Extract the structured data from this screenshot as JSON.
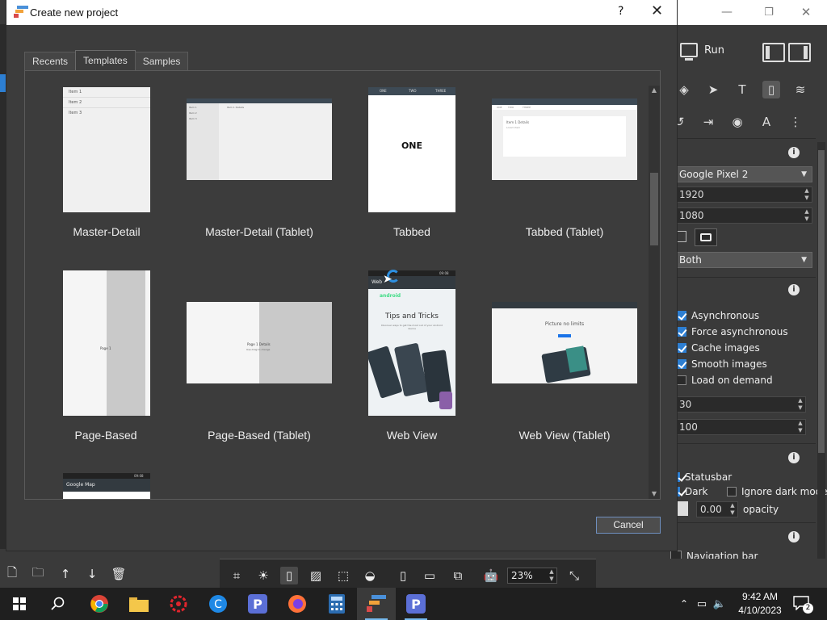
{
  "dialog": {
    "title": "Create new project",
    "help_label": "?",
    "close_label": "✕",
    "cancel_label": "Cancel",
    "tabs": [
      {
        "label": "Recents",
        "active": false
      },
      {
        "label": "Templates",
        "active": true
      },
      {
        "label": "Samples",
        "active": false
      }
    ],
    "templates": [
      {
        "label": "Master-Detail",
        "preview_items": [
          "Item 1",
          "Item 2",
          "Item 3"
        ]
      },
      {
        "label": "Master-Detail (Tablet)",
        "preview_items": [
          "Item 1",
          "Item 2",
          "Item 3"
        ],
        "preview_detail": "Item 1 Details"
      },
      {
        "label": "Tabbed",
        "preview_tabs": [
          "ONE",
          "TWO",
          "THREE"
        ],
        "preview_text": "ONE"
      },
      {
        "label": "Tabbed (Tablet)",
        "preview_tabs": [
          "ONE",
          "TWO",
          "THREE"
        ],
        "preview_text": "Item 1 Details",
        "preview_sub": "Lorem Item"
      },
      {
        "label": "Page-Based",
        "preview_text": "Page 1"
      },
      {
        "label": "Page-Based (Tablet)",
        "preview_text": "Page 1 Details",
        "preview_sub": "Use drag to change"
      },
      {
        "label": "Web View",
        "preview_time": "09:08",
        "preview_bar": "Web",
        "preview_brand": "android",
        "preview_heading": "Tips and Tricks",
        "preview_sub": "Discover ways to get the most out of your Android device"
      },
      {
        "label": "Web View (Tablet)",
        "preview_heading": "Picture no limits"
      },
      {
        "label": "Google Map",
        "preview_time": "09:08",
        "preview_bar": "Google Map"
      }
    ]
  },
  "right_panel": {
    "run_label": "Run",
    "device": "Google Pixel 2",
    "height_value": "1920",
    "width_value": "1080",
    "orientation_dropdown": "Both",
    "checks": [
      {
        "label": "Asynchronous",
        "checked": true
      },
      {
        "label": "Force asynchronous",
        "checked": true
      },
      {
        "label": "Cache images",
        "checked": true
      },
      {
        "label": "Smooth images",
        "checked": true
      },
      {
        "label": "Load on demand",
        "checked": false
      }
    ],
    "field_a": "30",
    "field_b": "100",
    "statusbar_label": "Statusbar",
    "dark_label": "Dark",
    "ignore_dark_label": "Ignore dark mode",
    "opacity_value": "0.00",
    "opacity_label": "opacity",
    "navigation_bar_label": "Navigation bar",
    "info_glyph": "i"
  },
  "bottom_toolbar": {
    "zoom_value": "23%"
  },
  "taskbar": {
    "time": "9:42 AM",
    "date": "4/10/2023",
    "notification_count": "2"
  },
  "colors": {
    "accent": "#2d7fd3",
    "dialog_bg": "#3c3c3c",
    "titlebar_bg": "#ffffff",
    "taskbar_bg": "#1f1f1f"
  }
}
